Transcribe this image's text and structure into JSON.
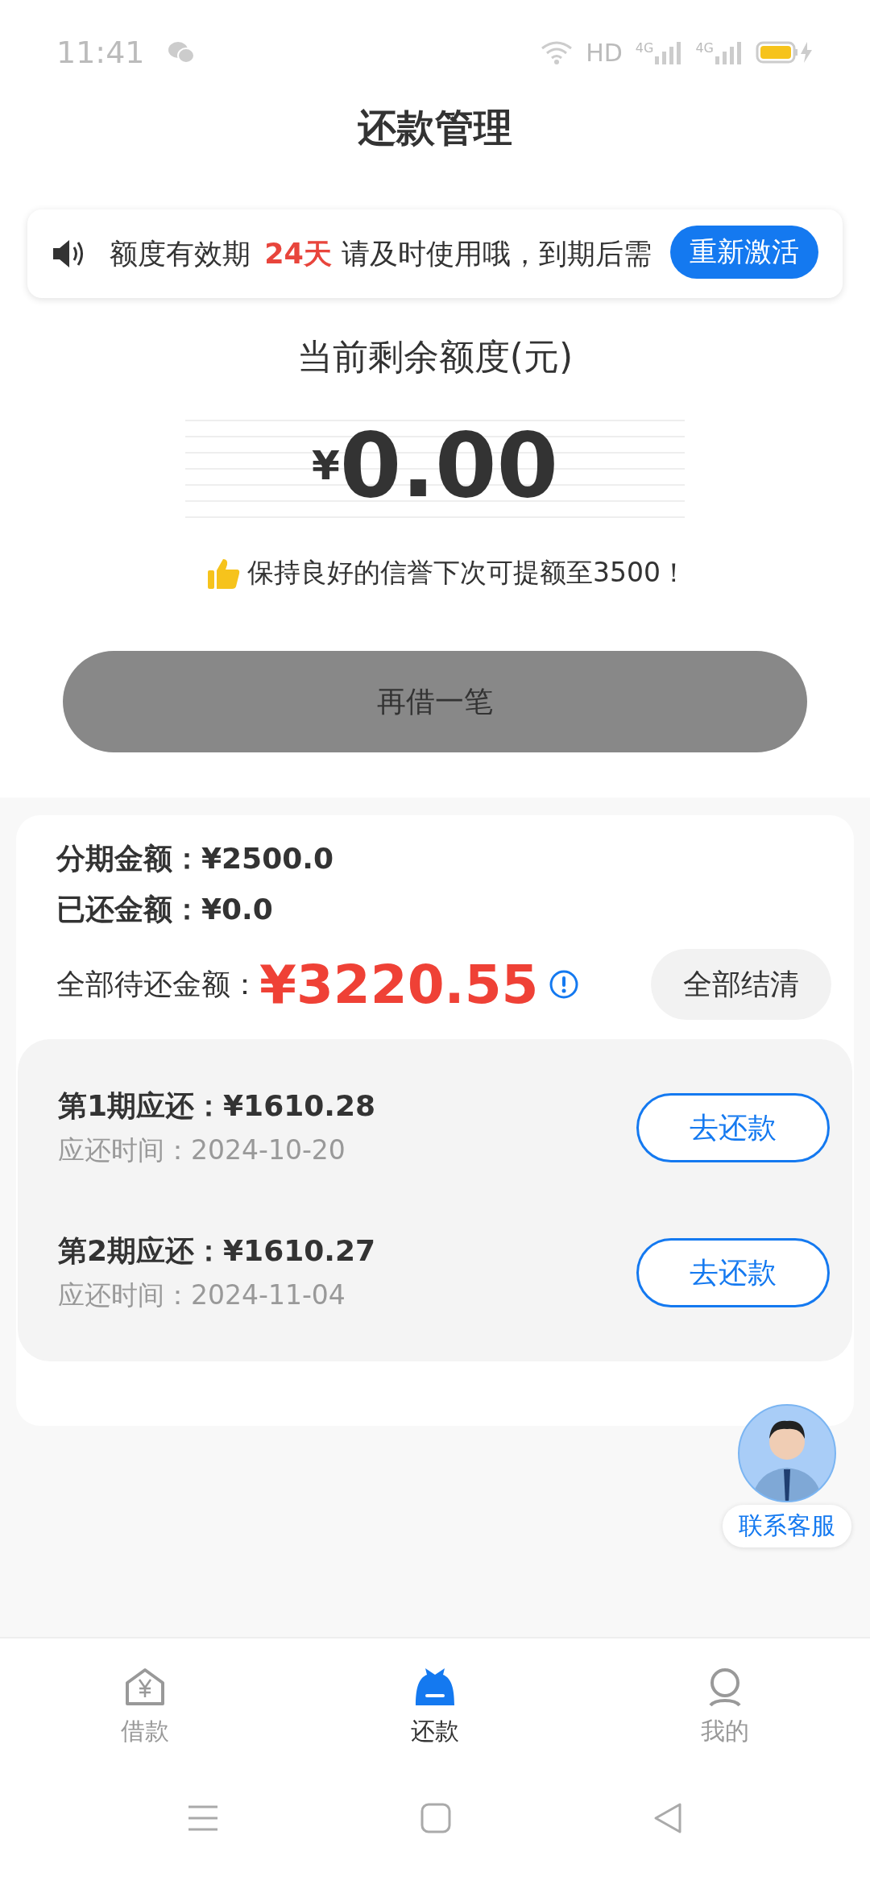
{
  "status_bar": {
    "time": "11:41",
    "network": "HD",
    "signals": [
      {
        "label": "4G"
      },
      {
        "label": "4G"
      }
    ]
  },
  "title": "还款管理",
  "notice": {
    "prefix": "额度有效期",
    "highlight": "24天",
    "suffix": "请及时使用哦，到期后需",
    "button": "重新激活"
  },
  "balance": {
    "label": "当前剩余额度(元)",
    "currency": "¥",
    "value": "0.00",
    "tip": "保持良好的信誉下次可提额至3500！"
  },
  "borrow_button": {
    "label": "再借一笔",
    "disabled": true
  },
  "loan": {
    "installment_amount": "分期金额：¥2500.0",
    "repaid_amount": "已还金额：¥0.0",
    "total_label": "全部待还金额：",
    "total_value": "¥3220.55",
    "settle_button": "全部结清"
  },
  "installments": [
    {
      "title": "第1期应还：¥1610.28",
      "due": "应还时间：2024-10-20",
      "button": "去还款"
    },
    {
      "title": "第2期应还：¥1610.27",
      "due": "应还时间：2024-11-04",
      "button": "去还款"
    }
  ],
  "support": {
    "label": "联系客服"
  },
  "tabs": [
    {
      "label": "借款",
      "kind": "borrow",
      "selected": false
    },
    {
      "label": "还款",
      "kind": "repay",
      "selected": true
    },
    {
      "label": "我的",
      "kind": "me",
      "selected": false
    }
  ]
}
